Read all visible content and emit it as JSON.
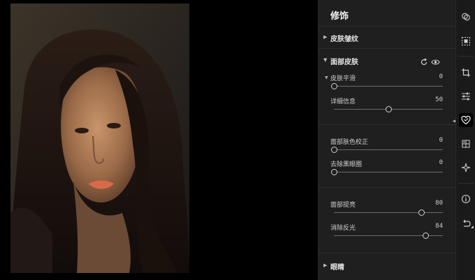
{
  "panel": {
    "title": "修饰",
    "sections": {
      "skin_wrinkles": {
        "label": "皮肤皱纹"
      },
      "face_skin": {
        "label": "面部皮肤"
      },
      "eyes": {
        "label": "眼睛"
      }
    },
    "params": [
      {
        "label": "皮肤平滑",
        "value": "0",
        "level": 0
      },
      {
        "label": "详细信息",
        "value": "50",
        "level": 0.5
      },
      {
        "label": "面部肤色校正",
        "value": "0",
        "level": 0
      },
      {
        "label": "去除黑眼圈",
        "value": "0",
        "level": 0
      },
      {
        "label": "面部提亮",
        "value": "80",
        "level": 0.8
      },
      {
        "label": "消除反光",
        "value": "84",
        "level": 0.84
      }
    ]
  },
  "toolbar": {
    "icons": [
      "overlap-circles-icon",
      "selection-frame-icon",
      "crop-icon",
      "sliders-icon",
      "heart-retouch-icon",
      "grid-icon",
      "sparkle-icon",
      "info-icon",
      "undo-icon"
    ],
    "active": "heart-retouch-icon"
  }
}
